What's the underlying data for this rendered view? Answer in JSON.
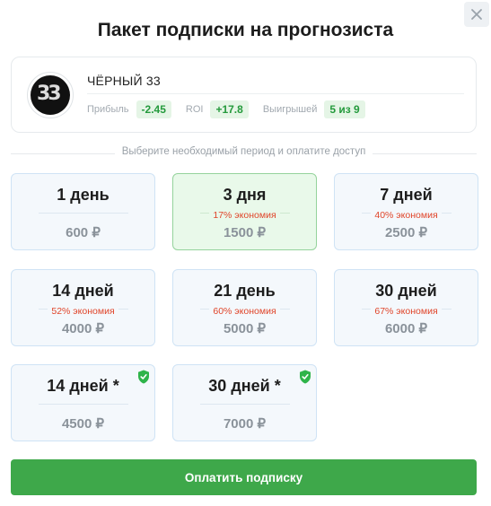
{
  "modal": {
    "title": "Пакет подписки на прогнозиста",
    "close_icon": "close-icon"
  },
  "profile": {
    "name": "ЧЁРНЫЙ 33",
    "avatar_text": "33",
    "profit_label": "Прибыль",
    "profit_value": "-2.45",
    "roi_label": "ROI",
    "roi_value": "+17.8",
    "wins_label": "Выигрышей",
    "wins_value": "5 из 9"
  },
  "hint": "Выберите необходимый период и оплатите доступ",
  "plans": [
    {
      "title": "1 день",
      "saving": "",
      "price": "600 ₽",
      "selected": false,
      "shield": false
    },
    {
      "title": "3 дня",
      "saving": "17% экономия",
      "price": "1500 ₽",
      "selected": true,
      "shield": false
    },
    {
      "title": "7 дней",
      "saving": "40% экономия",
      "price": "2500 ₽",
      "selected": false,
      "shield": false
    },
    {
      "title": "14 дней",
      "saving": "52% экономия",
      "price": "4000 ₽",
      "selected": false,
      "shield": false
    },
    {
      "title": "21 день",
      "saving": "60% экономия",
      "price": "5000 ₽",
      "selected": false,
      "shield": false
    },
    {
      "title": "30 дней",
      "saving": "67% экономия",
      "price": "6000 ₽",
      "selected": false,
      "shield": false
    },
    {
      "title": "14 дней *",
      "saving": "",
      "price": "4500 ₽",
      "selected": false,
      "shield": true
    },
    {
      "title": "30 дней *",
      "saving": "",
      "price": "7000 ₽",
      "selected": false,
      "shield": true
    }
  ],
  "pay_button": "Оплатить подписку",
  "colors": {
    "accent_green": "#3ea84a",
    "saving_red": "#e0452a",
    "card_border": "#cfe3f5",
    "selected_bg": "#e9f9ea"
  }
}
